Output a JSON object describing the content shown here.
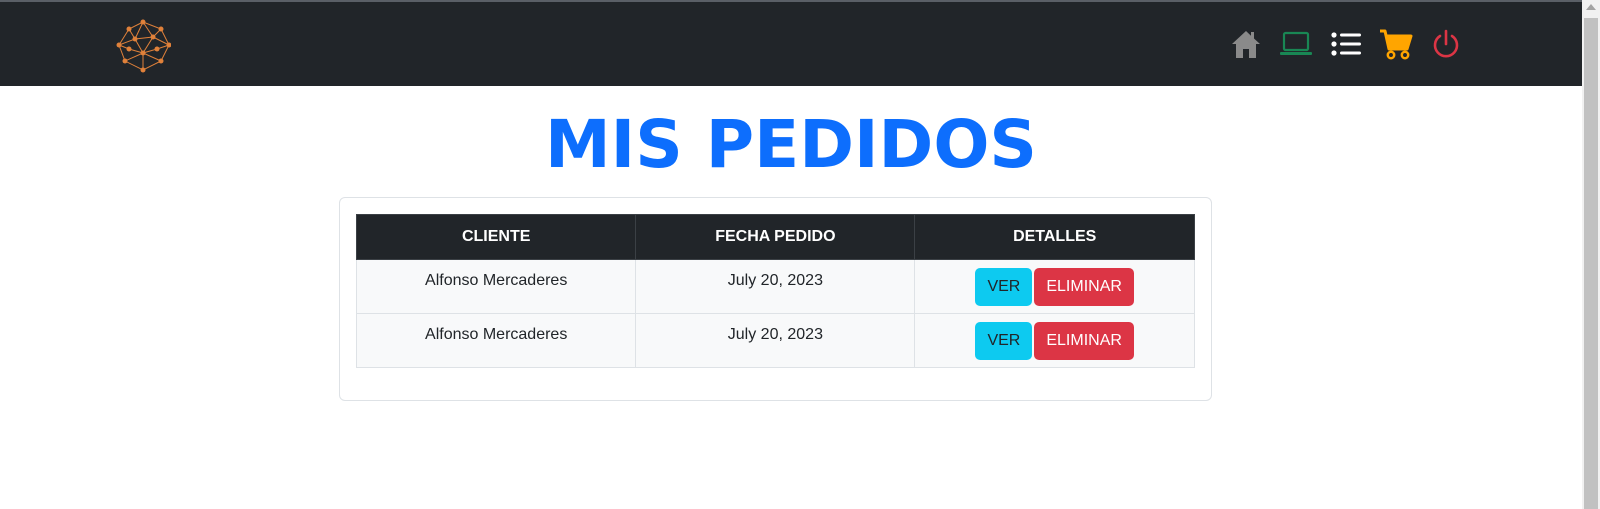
{
  "colors": {
    "navbar": "#212529",
    "title": "#0d6efd",
    "home_icon": "#8a8a8a",
    "laptop_icon": "#198754",
    "list_icon": "#ffffff",
    "cart_icon": "#ffa500",
    "power_icon": "#dc3545",
    "ver_button": "#0dcaf0",
    "eliminar_button": "#dc3545"
  },
  "navbar": {
    "logo": "network-logo",
    "icons": [
      "home-icon",
      "laptop-icon",
      "list-icon",
      "cart-icon",
      "power-icon"
    ]
  },
  "page": {
    "title": "MIS PEDIDOS"
  },
  "table": {
    "headers": [
      "CLIENTE",
      "FECHA PEDIDO",
      "DETALLES"
    ],
    "rows": [
      {
        "cliente": "Alfonso Mercaderes",
        "fecha": "July 20, 2023",
        "ver": "VER",
        "eliminar": "ELIMINAR"
      },
      {
        "cliente": "Alfonso Mercaderes",
        "fecha": "July 20, 2023",
        "ver": "VER",
        "eliminar": "ELIMINAR"
      }
    ]
  }
}
